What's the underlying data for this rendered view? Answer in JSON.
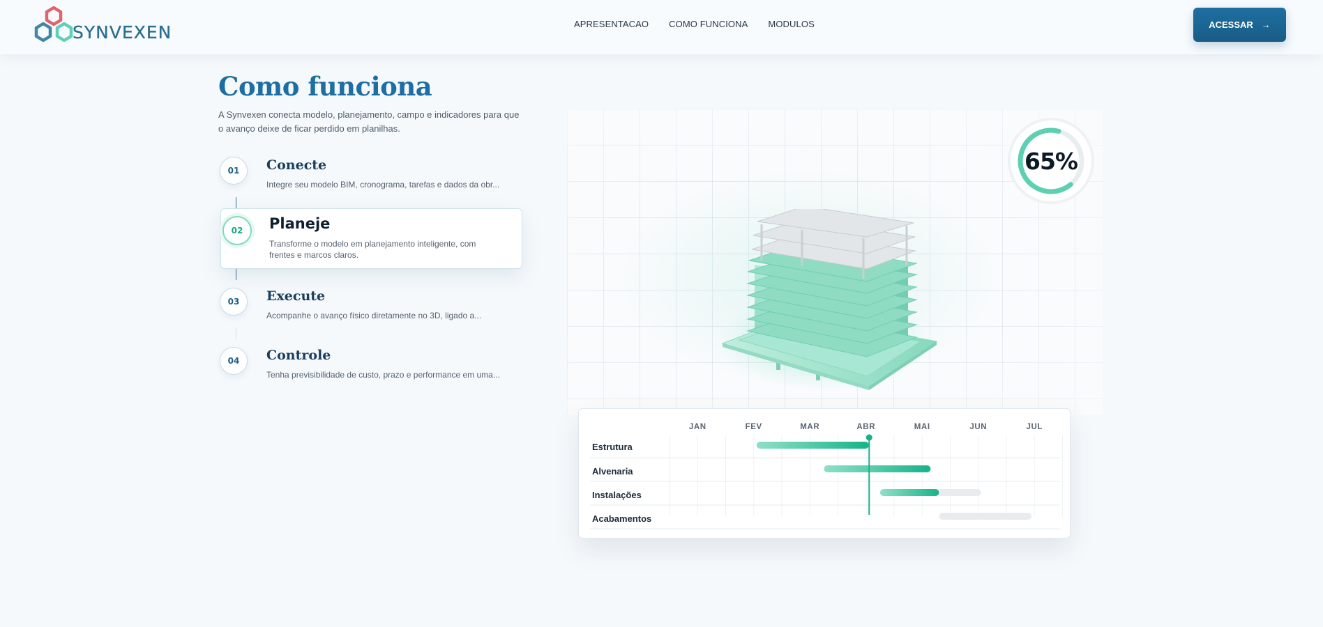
{
  "header": {
    "logo_text": "SYNVEXEN",
    "nav": [
      "APRESENTACAO",
      "COMO FUNCIONA",
      "MODULOS"
    ],
    "cta_label": "ACESSAR",
    "cta_icon": "arrow-right-icon"
  },
  "section": {
    "title": "Como funciona",
    "description": "A Synvexen conecta modelo, planejamento, campo e indicadores para que o avanço deixe de ficar perdido em planilhas."
  },
  "steps": [
    {
      "number": "01",
      "title": "Conecte",
      "text": "Integre seu modelo BIM, cronograma, tarefas e dados da obr..."
    },
    {
      "number": "02",
      "title": "Planeje",
      "text": "Transforme o modelo em planejamento inteligente, com frentes e marcos claros.",
      "active": true
    },
    {
      "number": "03",
      "title": "Execute",
      "text": "Acompanhe o avanço físico diretamente no 3D, ligado a..."
    },
    {
      "number": "04",
      "title": "Controle",
      "text": "Tenha previsibilidade de custo, prazo e performance em uma..."
    }
  ],
  "progress": {
    "label": "65%",
    "value": 0.65
  },
  "gantt": {
    "months": [
      "JAN",
      "FEV",
      "MAR",
      "ABR",
      "MAI",
      "JUN",
      "JUL"
    ],
    "rows": [
      {
        "label": "Estrutura",
        "done_start": 1.55,
        "done_end": 3.55,
        "plan_end": 3.55
      },
      {
        "label": "Alvenaria",
        "done_start": 2.75,
        "done_end": 4.65,
        "plan_end": 4.65
      },
      {
        "label": "Instalações",
        "done_start": 3.75,
        "done_end": 4.8,
        "plan_end": 5.55
      },
      {
        "label": "Acabamentos",
        "done_start": 4.85,
        "done_end": 4.85,
        "plan_end": 6.45
      }
    ],
    "today": 3.55
  },
  "colors": {
    "brand_blue": "#1d6fa3",
    "accent_green": "#1cb58f",
    "dark_text": "#0e1a26"
  }
}
